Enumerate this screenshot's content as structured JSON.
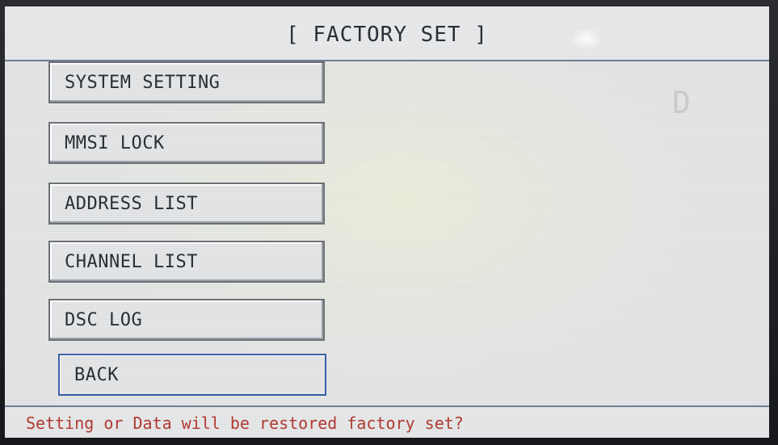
{
  "title": "[ FACTORY SET ]",
  "menu": {
    "items": [
      {
        "label": "SYSTEM SETTING"
      },
      {
        "label": "MMSI LOCK"
      },
      {
        "label": "ADDRESS LIST"
      },
      {
        "label": "CHANNEL LIST"
      },
      {
        "label": "DSC LOG"
      },
      {
        "label": "BACK",
        "selected": true
      }
    ]
  },
  "indicator": {
    "text": "D"
  },
  "status": {
    "message": "Setting or Data will be restored factory set?",
    "color": "#b03a32"
  },
  "colors": {
    "frame_line": "#6f7f98",
    "selected_border": "#3b5ea8"
  }
}
